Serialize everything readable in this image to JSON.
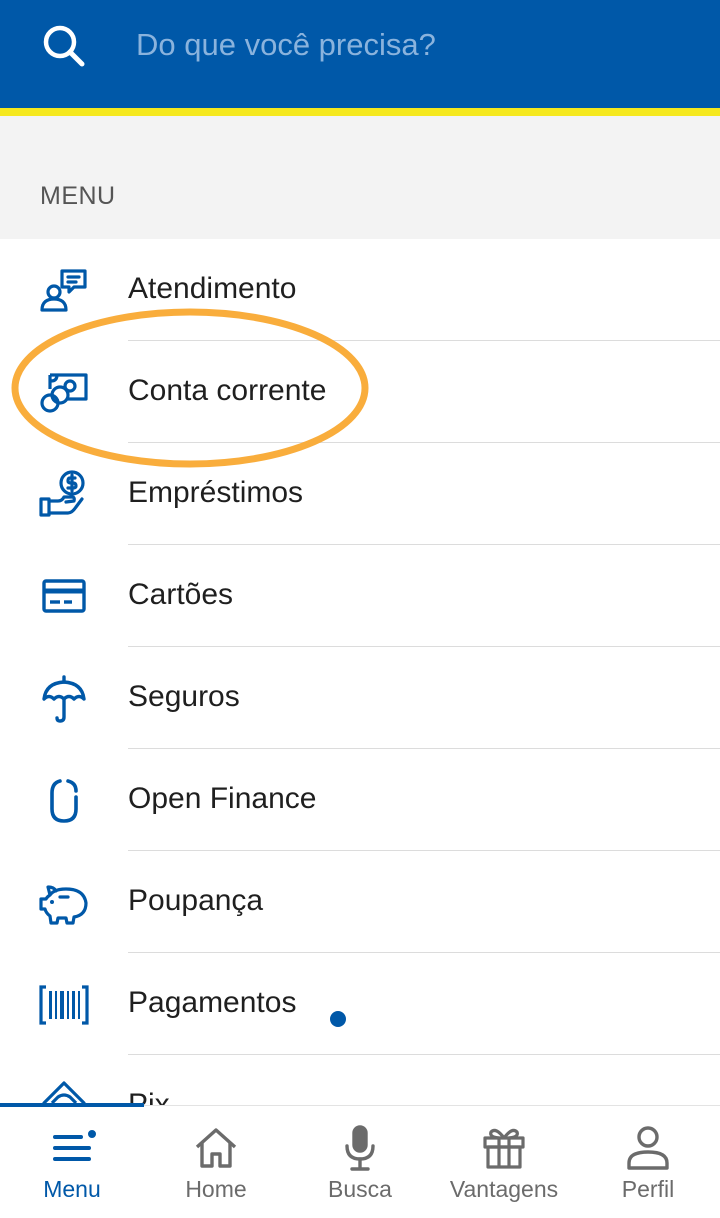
{
  "search": {
    "placeholder": "Do que você precisa?",
    "icon": "search-icon"
  },
  "section": {
    "title": "MENU"
  },
  "menu": {
    "items": [
      {
        "label": "Atendimento",
        "icon": "chat-person-icon"
      },
      {
        "label": "Conta corrente",
        "icon": "money-coins-icon",
        "highlighted": true
      },
      {
        "label": "Empréstimos",
        "icon": "hand-coin-icon"
      },
      {
        "label": "Cartões",
        "icon": "credit-card-icon"
      },
      {
        "label": "Seguros",
        "icon": "umbrella-icon"
      },
      {
        "label": "Open Finance",
        "icon": "open-finance-icon"
      },
      {
        "label": "Poupança",
        "icon": "piggy-bank-icon"
      },
      {
        "label": "Pagamentos",
        "icon": "barcode-icon",
        "badge": true
      },
      {
        "label": "Pix",
        "icon": "pix-icon"
      }
    ]
  },
  "tabs": [
    {
      "label": "Menu",
      "icon": "menu-icon",
      "active": true,
      "badge": true
    },
    {
      "label": "Home",
      "icon": "home-icon"
    },
    {
      "label": "Busca",
      "icon": "microphone-icon"
    },
    {
      "label": "Vantagens",
      "icon": "gift-icon"
    },
    {
      "label": "Perfil",
      "icon": "person-icon"
    }
  ],
  "colors": {
    "brand_blue": "#0058a8",
    "brand_yellow": "#f5e81e",
    "highlight_orange": "#f9ad3c"
  }
}
